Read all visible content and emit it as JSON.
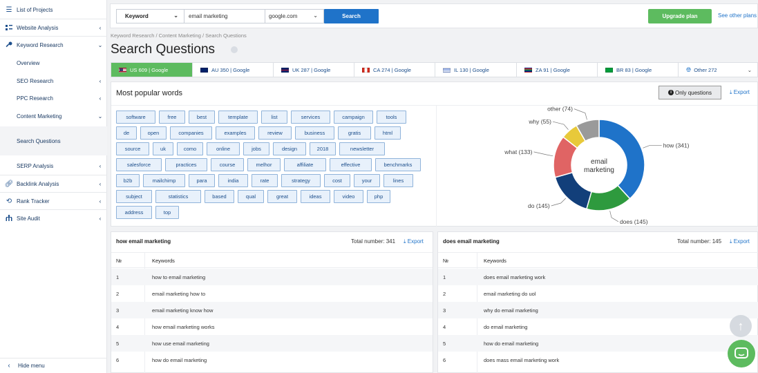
{
  "sidebar": {
    "items": [
      {
        "label": "List of Projects",
        "icon": "list-icon",
        "chevron": ""
      },
      {
        "label": "Website Analysis",
        "icon": "analysis-icon",
        "chevron": "‹"
      },
      {
        "label": "Keyword Research",
        "icon": "key-icon",
        "chevron": "⌄"
      },
      {
        "label": "Overview",
        "icon": "",
        "chevron": ""
      },
      {
        "label": "SEO Research",
        "icon": "",
        "chevron": "‹"
      },
      {
        "label": "PPC Research",
        "icon": "",
        "chevron": "‹"
      },
      {
        "label": "Content Marketing",
        "icon": "",
        "chevron": "⌄"
      },
      {
        "label": "Search Questions",
        "icon": "",
        "chevron": ""
      },
      {
        "label": "SERP Analysis",
        "icon": "",
        "chevron": "‹"
      },
      {
        "label": "Backlink Analysis",
        "icon": "link-icon",
        "chevron": "‹"
      },
      {
        "label": "Rank Tracker",
        "icon": "refresh-icon",
        "chevron": "‹"
      },
      {
        "label": "Site Audit",
        "icon": "sitemap-icon",
        "chevron": "‹"
      }
    ],
    "hide_menu": "Hide menu",
    "hide_chev": "‹"
  },
  "search": {
    "type_value": "Keyword",
    "query_value": "email marketing",
    "db_value": "google.com",
    "search_label": "Search"
  },
  "header": {
    "upgrade_label": "Upgrade plan",
    "other_plans_label": "See other plans",
    "breadcrumb": "Keyword Research / Content Marketing / Search Questions",
    "title": "Search Questions"
  },
  "db_tabs": [
    {
      "label": "US 609 | Google",
      "flag": "us"
    },
    {
      "label": "AU 350 | Google",
      "flag": "au"
    },
    {
      "label": "UK 287 | Google",
      "flag": "uk"
    },
    {
      "label": "CA 274 | Google",
      "flag": "ca"
    },
    {
      "label": "IL 130 | Google",
      "flag": "il"
    },
    {
      "label": "ZA 91 | Google",
      "flag": "za"
    },
    {
      "label": "BR 83 | Google",
      "flag": "br"
    },
    {
      "label": "Other 272",
      "flag": "globe"
    }
  ],
  "words": {
    "title": "Most popular words",
    "only_questions_label": "Only questions",
    "export_label": "Export",
    "chips": [
      [
        "software",
        "free",
        "best",
        "template",
        "list",
        "services",
        "campaign",
        "tools"
      ],
      [
        "de",
        "open",
        "companies",
        "examples",
        "review",
        "business",
        "gratis",
        "html"
      ],
      [
        "source",
        "uk",
        "como",
        "online",
        "jobs",
        "design",
        "2018",
        "newsletter"
      ],
      [
        "salesforce",
        "practices",
        "course",
        "melhor",
        "affiliate",
        "effective",
        "benchmarks"
      ],
      [
        "b2b",
        "mailchimp",
        "para",
        "india",
        "rate",
        "strategy",
        "cost",
        "your",
        "lines"
      ],
      [
        "subject",
        "statistics",
        "based",
        "qual",
        "great",
        "ideas",
        "video",
        "php"
      ],
      [
        "address",
        "top"
      ]
    ]
  },
  "chart_data": {
    "type": "pie",
    "center_label": [
      "email",
      "marketing"
    ],
    "slices": [
      {
        "label": "how (341)",
        "value": 341,
        "color": "#1f73c9"
      },
      {
        "label": "does (145)",
        "value": 145,
        "color": "#2e9a3e"
      },
      {
        "label": "do (145)",
        "value": 145,
        "color": "#123f7a"
      },
      {
        "label": "what (133)",
        "value": 133,
        "color": "#e06464"
      },
      {
        "label": "why (55)",
        "value": 55,
        "color": "#e8c93a"
      },
      {
        "label": "other (74)",
        "value": 74,
        "color": "#9a9a9a"
      }
    ]
  },
  "tables": [
    {
      "title": "how email marketing",
      "total": "Total number: 341",
      "export_label": "Export",
      "col_num": "№",
      "col_kw": "Keywords",
      "rows": [
        {
          "n": "1",
          "kw": "how to email marketing"
        },
        {
          "n": "2",
          "kw": "email marketing how to"
        },
        {
          "n": "3",
          "kw": "email marketing know how"
        },
        {
          "n": "4",
          "kw": "how email marketing works"
        },
        {
          "n": "5",
          "kw": "how use email marketing"
        },
        {
          "n": "6",
          "kw": "how do email marketing"
        }
      ]
    },
    {
      "title": "does email marketing",
      "total": "Total number: 145",
      "export_label": "Export",
      "col_num": "№",
      "col_kw": "Keywords",
      "rows": [
        {
          "n": "1",
          "kw": "does email marketing work"
        },
        {
          "n": "2",
          "kw": "email marketing do uol"
        },
        {
          "n": "3",
          "kw": "why do email marketing"
        },
        {
          "n": "4",
          "kw": "do email marketing"
        },
        {
          "n": "5",
          "kw": "how do email marketing"
        },
        {
          "n": "6",
          "kw": "does mass email marketing work"
        }
      ]
    }
  ]
}
